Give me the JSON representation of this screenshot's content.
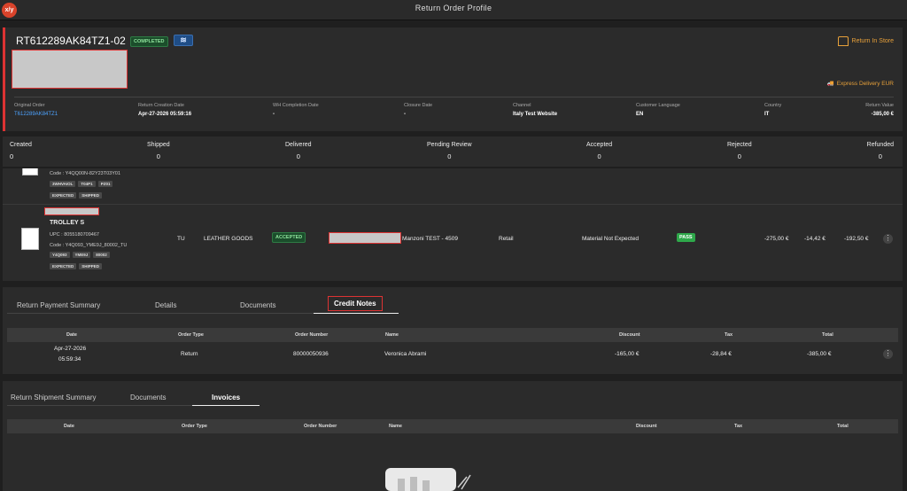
{
  "app": {
    "logo": "x/y",
    "title": "Return Order Profile"
  },
  "order": {
    "id": "RT612289AK84TZ1-02",
    "status": "COMPLETED",
    "return_type": "Return In Store",
    "delivery": "Express Delivery EUR",
    "meta": [
      {
        "label": "Original Order",
        "value": "T612289AK84TZ1",
        "link": true
      },
      {
        "label": "Return Creation Date",
        "value": "Apr-27-2026 05:59:16"
      },
      {
        "label": "WH Completion Date",
        "value": "-"
      },
      {
        "label": "Closure Date",
        "value": "-"
      },
      {
        "label": "Channel",
        "value": "Italy Test Website"
      },
      {
        "label": "Customer Language",
        "value": "EN"
      },
      {
        "label": "Country",
        "value": "IT"
      },
      {
        "label": "Return Value",
        "value": "-385,00 €"
      }
    ]
  },
  "stats": [
    {
      "label": "Created",
      "value": "0"
    },
    {
      "label": "Shipped",
      "value": "0"
    },
    {
      "label": "Delivered",
      "value": "0"
    },
    {
      "label": "Pending Review",
      "value": "0"
    },
    {
      "label": "Accepted",
      "value": "0"
    },
    {
      "label": "Rejected",
      "value": "0"
    },
    {
      "label": "Refunded",
      "value": "0"
    }
  ],
  "item1": {
    "code": "Code : Y4QQ00N-82Y23T03Y01",
    "tags": [
      "3WHVAIOL",
      "T04P1",
      "PZ01"
    ],
    "status_tags": [
      "EXPECTED",
      "SHIPPED"
    ]
  },
  "item2": {
    "name": "TROLLEY S",
    "upc": "UPC : 8055180709467",
    "code": "Code : Y4Q093_YME9J_80002_TU",
    "tags": [
      "Y4Q093",
      "YME9J",
      "80002"
    ],
    "status_tags": [
      "EXPECTED",
      "SHIPPED"
    ],
    "size": "TU",
    "category": "LEATHER GOODS",
    "status": "ACCEPTED",
    "store": "Manzoni TEST - 4509",
    "channel": "Retail",
    "material": "Material Not Expected",
    "qc": "PASS",
    "price": "-275,00 €",
    "tax": "-14,42 €",
    "total": "-192,50 €"
  },
  "payment": {
    "tabs": [
      "Return Payment Summary",
      "Details",
      "Documents",
      "Credit Notes"
    ],
    "columns": [
      "Date",
      "Order Type",
      "Order Number",
      "Name",
      "Discount",
      "Tax",
      "Total"
    ],
    "row": {
      "date": "Apr-27-2026",
      "time": "05:59:34",
      "order_type": "Return",
      "order_number": "80000050936",
      "name": "Veronica Abrami",
      "discount": "-165,00 €",
      "tax": "-28,84 €",
      "total": "-385,00 €"
    }
  },
  "shipment": {
    "tabs": [
      "Return Shipment Summary",
      "Documents",
      "Invoices"
    ],
    "columns": [
      "Date",
      "Order Type",
      "Order Number",
      "Name",
      "Discount",
      "Tax",
      "Total"
    ]
  },
  "colors": {
    "accent": "#e8a13a",
    "status_green": "#2ea84a",
    "link": "#4da3ff",
    "highlight": "#dd3333"
  }
}
